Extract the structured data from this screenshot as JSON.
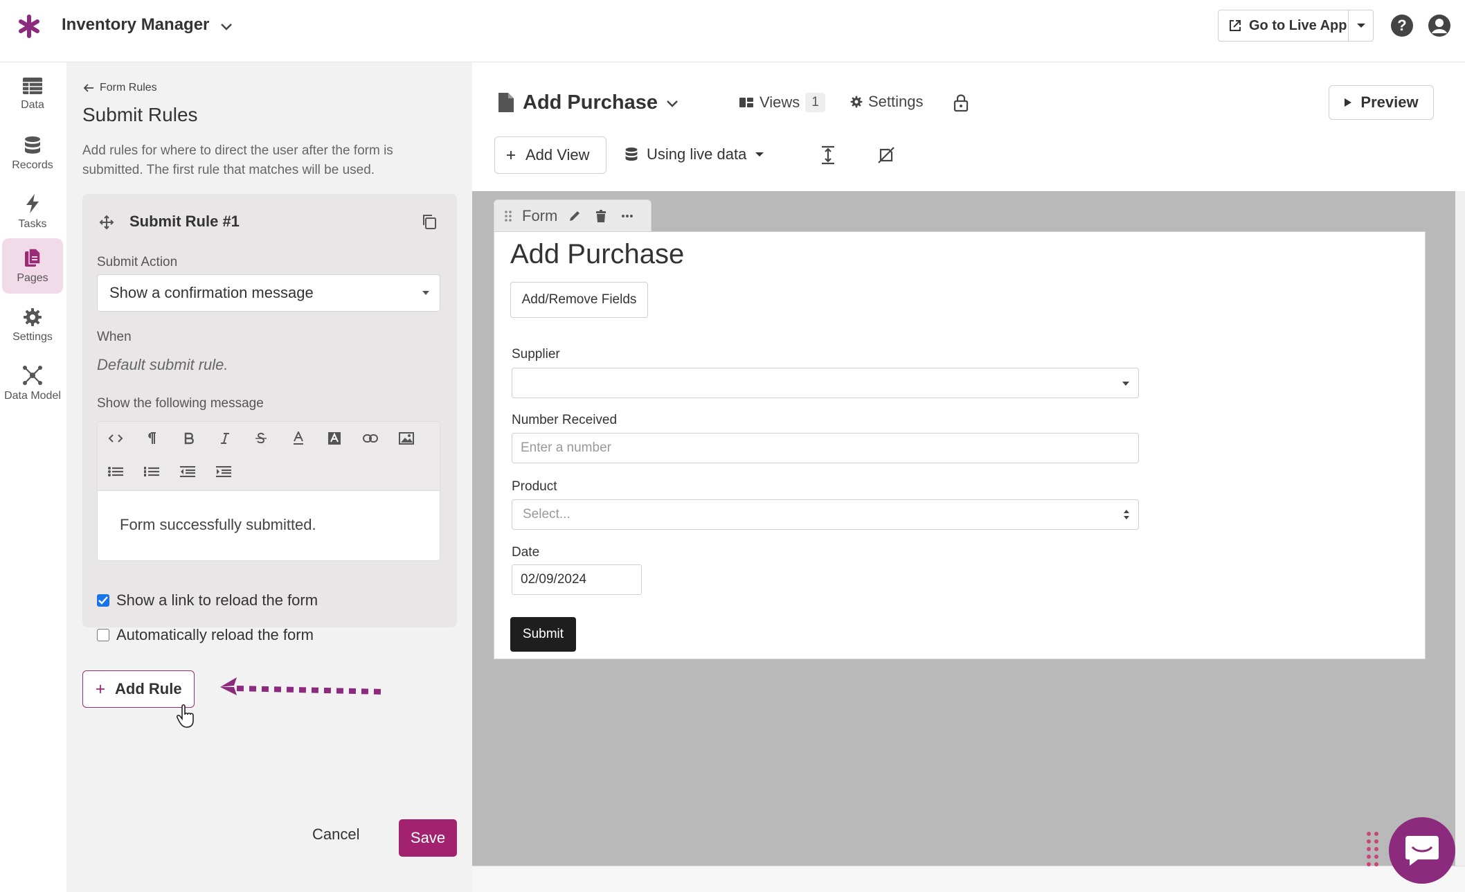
{
  "topbar": {
    "app_title": "Inventory Manager",
    "go_live_label": "Go to Live App"
  },
  "nav": {
    "items": [
      {
        "label": "Data",
        "icon": "table-icon"
      },
      {
        "label": "Records",
        "icon": "database-icon"
      },
      {
        "label": "Tasks",
        "icon": "lightning-icon"
      },
      {
        "label": "Pages",
        "icon": "pages-icon",
        "active": true
      },
      {
        "label": "Settings",
        "icon": "gear-icon"
      },
      {
        "label": "Data Model",
        "icon": "network-icon"
      }
    ]
  },
  "panel": {
    "back_label": "Form Rules",
    "title": "Submit Rules",
    "description": "Add rules for where to direct the user after the form is submitted. The first rule that matches will be used.",
    "rule": {
      "title": "Submit Rule #1",
      "submit_action_label": "Submit Action",
      "submit_action_value": "Show a confirmation message",
      "when_label": "When",
      "when_value": "Default submit rule.",
      "message_label": "Show the following message",
      "message_text": "Form successfully submitted.",
      "reload_link_label": "Show a link to reload the form",
      "reload_link_checked": true,
      "auto_reload_label": "Automatically reload the form",
      "auto_reload_checked": false
    },
    "add_rule_label": "Add Rule",
    "cancel_label": "Cancel",
    "save_label": "Save"
  },
  "main": {
    "page_title": "Add Purchase",
    "views_label": "Views",
    "views_count": "1",
    "settings_label": "Settings",
    "preview_label": "Preview",
    "add_view_label": "Add View",
    "data_mode_label": "Using live data"
  },
  "view": {
    "tab_label": "Form",
    "form_title": "Add Purchase",
    "add_remove_label": "Add/Remove Fields",
    "fields": {
      "supplier_label": "Supplier",
      "number_label": "Number Received",
      "number_placeholder": "Enter a number",
      "product_label": "Product",
      "product_placeholder": "Select...",
      "date_label": "Date",
      "date_value": "02/09/2024"
    },
    "submit_label": "Submit"
  },
  "colors": {
    "brand": "#8c2a7e",
    "save": "#a3226f",
    "active_nav": "#f2dbe9",
    "checkbox": "#1a73e8"
  }
}
